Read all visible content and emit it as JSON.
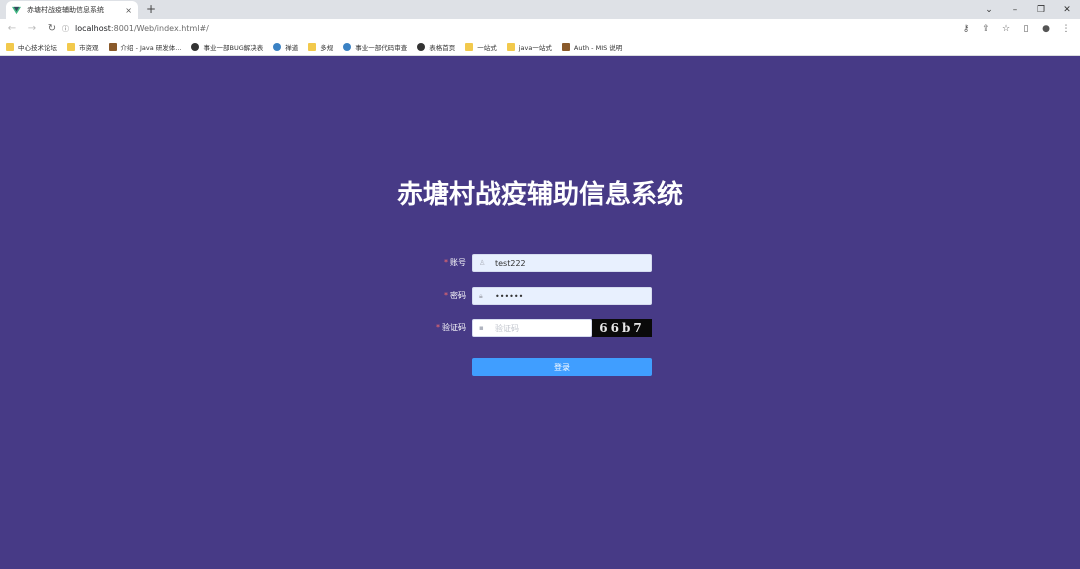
{
  "browser": {
    "tab_title": "赤塘村战疫辅助信息系统",
    "tab_close": "×",
    "new_tab": "+",
    "url_host": "localhost",
    "url_rest": ":8001/Web/index.html#/",
    "bookmarks": [
      {
        "label": "中心技术论坛",
        "icon": "folder-icon"
      },
      {
        "label": "市资观",
        "icon": "folder-icon"
      },
      {
        "label": "介绍 - Java 研发体...",
        "icon": "image-icon"
      },
      {
        "label": "事业一部BUG解决表",
        "icon": "globe-icon"
      },
      {
        "label": "禅道",
        "icon": "globe-icon"
      },
      {
        "label": "多规",
        "icon": "folder-icon"
      },
      {
        "label": "事业一部代码审查",
        "icon": "globe-icon"
      },
      {
        "label": "表格首页",
        "icon": "globe-icon"
      },
      {
        "label": "一站式",
        "icon": "folder-icon"
      },
      {
        "label": "java一站式",
        "icon": "folder-icon"
      },
      {
        "label": "Auth - MIS 说明",
        "icon": "image-icon"
      }
    ]
  },
  "login": {
    "title": "赤塘村战疫辅助信息系统",
    "username_label": "账号",
    "username_value": "test222",
    "password_label": "密码",
    "password_value": "••••••",
    "captcha_label": "验证码",
    "captcha_placeholder": "验证码",
    "captcha_text": "66b7",
    "login_button": "登录"
  },
  "colors": {
    "background": "#473a86",
    "button": "#409eff",
    "input_autofill": "#e8f0fe"
  }
}
